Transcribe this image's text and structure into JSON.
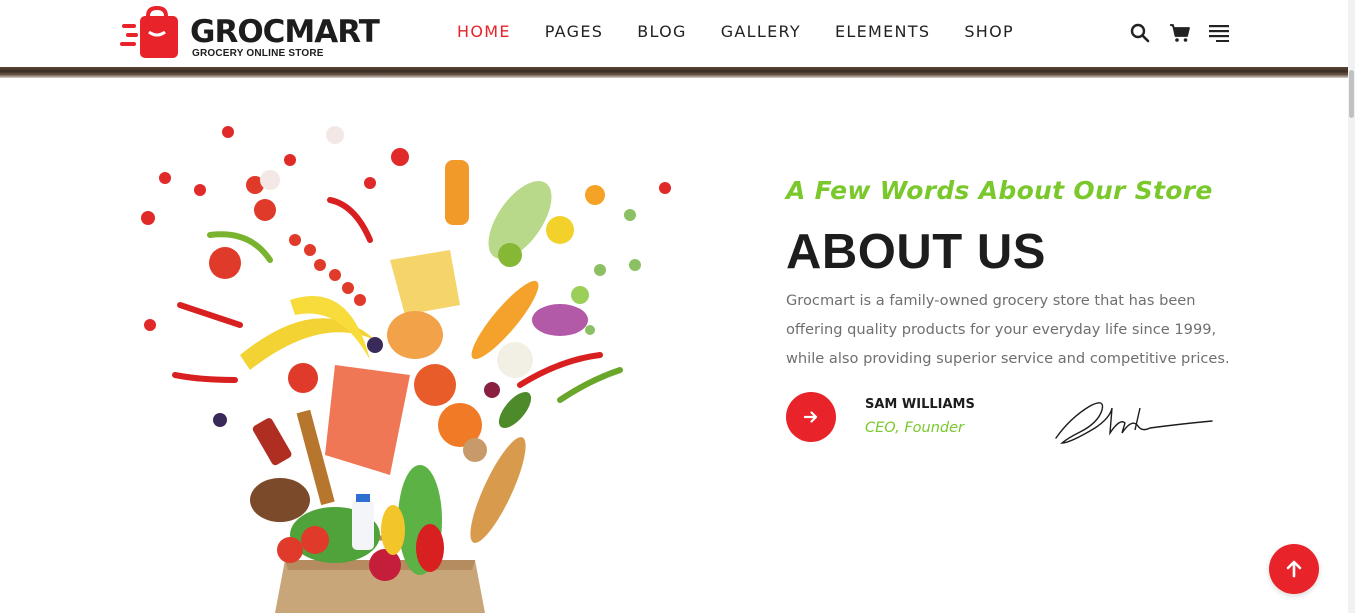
{
  "brand": {
    "name": "GROCMART",
    "subtitle": "GROCERY ONLINE STORE",
    "accent_color": "#e8232a",
    "green_color": "#7ac82c"
  },
  "nav": {
    "items": [
      {
        "label": "HOME",
        "active": true
      },
      {
        "label": "PAGES",
        "active": false
      },
      {
        "label": "BLOG",
        "active": false
      },
      {
        "label": "GALLERY",
        "active": false
      },
      {
        "label": "ELEMENTS",
        "active": false
      },
      {
        "label": "SHOP",
        "active": false
      }
    ],
    "icons": [
      "search-icon",
      "cart-icon",
      "menu-icon"
    ]
  },
  "about": {
    "tagline": "A Few Words About Our Store",
    "heading": "ABOUT US",
    "description": "Grocmart is a family-owned grocery store that has been offering quality products for your everyday life since 1999, while also providing superior service and competitive prices.",
    "person_name": "SAM WILLIAMS",
    "person_role": "CEO, Founder"
  },
  "floating": {
    "back_to_top_icon": "arrow-up-icon"
  }
}
